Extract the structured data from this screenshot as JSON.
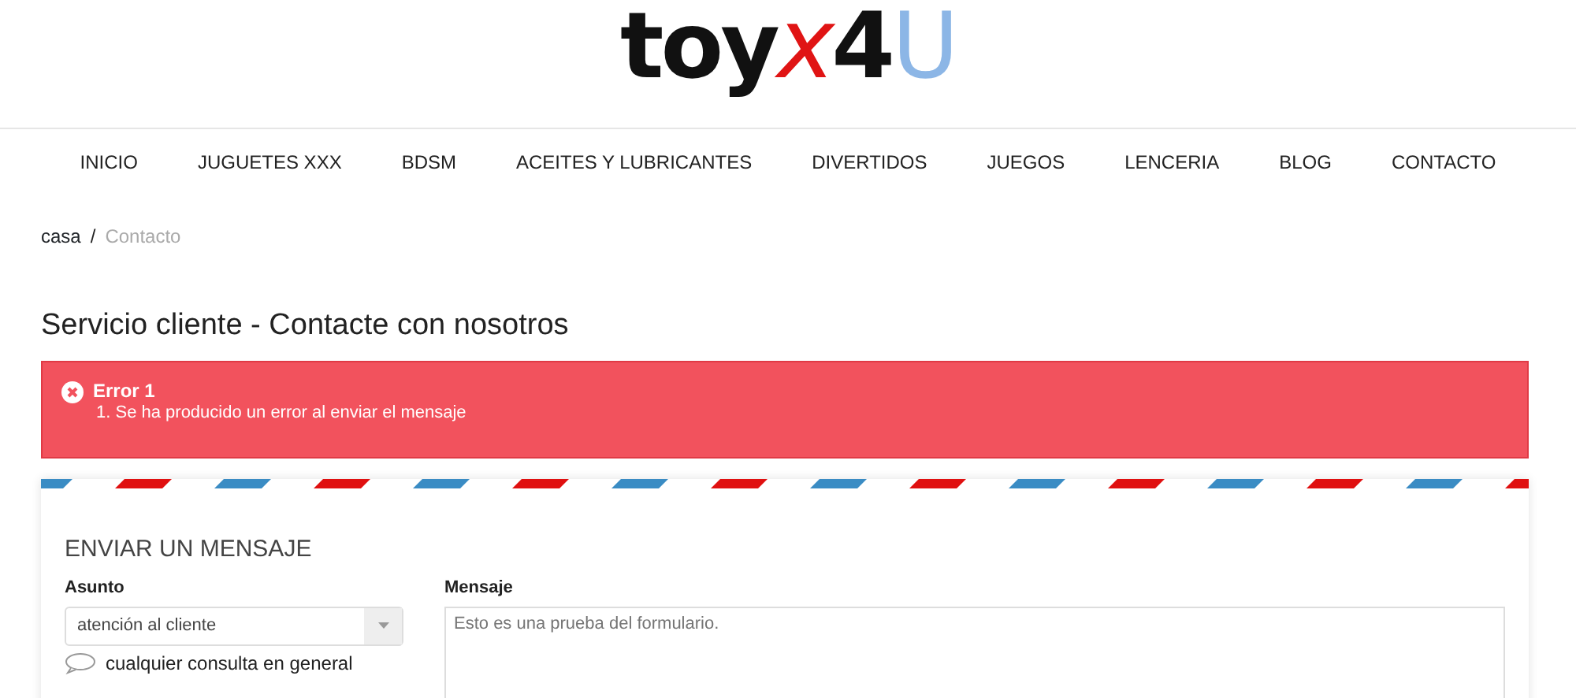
{
  "logo": [
    {
      "text": "toy",
      "color": "#111111"
    },
    {
      "text": "x",
      "color": "#e01414"
    },
    {
      "text": "4",
      "color": "#111111"
    },
    {
      "text": "U",
      "color": "#8cb6e6"
    }
  ],
  "nav": [
    "INICIO",
    "JUGUETES XXX",
    "BDSM",
    "ACEITES Y LUBRICANTES",
    "DIVERTIDOS",
    "JUEGOS",
    "LENCERIA",
    "BLOG",
    "CONTACTO"
  ],
  "breadcrumb_separator": "/",
  "breadcrumb": [
    {
      "label": "casa",
      "current": false
    },
    {
      "label": "Contacto",
      "current": true
    }
  ],
  "title": "Servicio cliente - Contacte con nosotros",
  "alert": {
    "title": "Error 1",
    "items": [
      "1. Se ha producido un error al enviar el mensaje"
    ]
  },
  "form": {
    "heading": "ENVIAR UN MENSAJE",
    "subject": {
      "label": "Asunto",
      "value": "atención al cliente",
      "hint": "cualquier consulta en general"
    },
    "message": {
      "label": "Mensaje",
      "placeholder": "Esto es una prueba del formulario."
    }
  }
}
